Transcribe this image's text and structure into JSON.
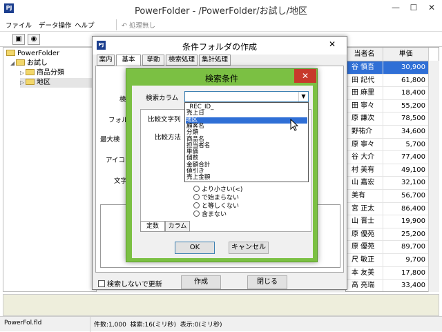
{
  "main": {
    "title": "PowerFolder - /PowerFolder/お試し/地区",
    "menu": [
      "ファイル",
      "データ操作",
      "ヘルプ"
    ],
    "toolbar_undo_label": "処理無し"
  },
  "tree": {
    "items": [
      "PowerFolder",
      "お試し",
      "商品分類",
      "地区"
    ]
  },
  "grid": {
    "headers": [
      "当者名",
      "単価"
    ],
    "rows": [
      [
        "谷 慎吾",
        "30,900"
      ],
      [
        "田 記代",
        "61,800"
      ],
      [
        "田 麻里",
        "18,400"
      ],
      [
        "田 寧々",
        "55,200"
      ],
      [
        "原 謙次",
        "78,500"
      ],
      [
        "野祐介",
        "34,600"
      ],
      [
        "原 寧々",
        "5,700"
      ],
      [
        "谷 大介",
        "77,400"
      ],
      [
        "村 美有",
        "49,100"
      ],
      [
        "山 嘉宏",
        "32,100"
      ],
      [
        "美有",
        "56,700"
      ],
      [
        "宮 正太",
        "86,400"
      ],
      [
        "山 晋士",
        "19,900"
      ],
      [
        "原 優苑",
        "25,200"
      ],
      [
        "原 優苑",
        "89,700"
      ],
      [
        "尺 敏正",
        "9,700"
      ],
      [
        "本 友美",
        "17,800"
      ],
      [
        "高 亮瑞",
        "33,400"
      ]
    ]
  },
  "status": {
    "file": "PowerFol.fld",
    "info": "件数:1,000  検索:16(ミリ秒)  表示:0(ミリ秒)"
  },
  "dialog1": {
    "title": "条件フォルダの作成",
    "tabs": [
      "案内",
      "基本",
      "挙動",
      "検索処理",
      "集計処理"
    ],
    "labels": [
      "検",
      "フォル",
      "最大検",
      "アイコ",
      "文字"
    ],
    "update_checkbox": "検索しないで更新",
    "create_button": "作成",
    "close_button": "閉じる"
  },
  "dialog2": {
    "title": "検索条件",
    "column_label": "検索カラム",
    "compare_text_label": "比較文字列",
    "compare_method_label": "比較方法",
    "dropdown_items": [
      "_REC_ID_",
      "売上日",
      "地区",
      "顧客名",
      "分類",
      "商品名",
      "担当者名",
      "単価",
      "個数",
      "金額合計",
      "値引き",
      "売上金額"
    ],
    "selected_index": 2,
    "radio_items": [
      "より小さい(<)",
      "で始まらない",
      "と等しくない",
      "含まない"
    ],
    "subtabs": [
      "定数",
      "カラム"
    ],
    "ok_button": "OK",
    "cancel_button": "キャンセル"
  }
}
